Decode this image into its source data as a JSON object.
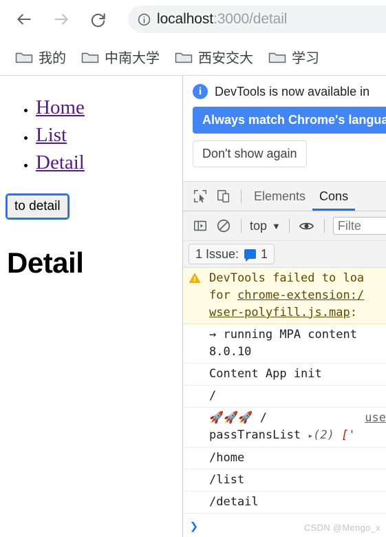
{
  "browser": {
    "nav": {
      "back_label": "Back",
      "forward_label": "Forward",
      "reload_label": "Reload"
    },
    "omnibox": {
      "site_info_icon": "info-circle-icon",
      "host": "localhost",
      "path": ":3000/detail",
      "full_url": "localhost:3000/detail"
    },
    "bookmarks": [
      {
        "label": "我的",
        "icon": "folder-icon"
      },
      {
        "label": "中南大学",
        "icon": "folder-icon"
      },
      {
        "label": "西安交大",
        "icon": "folder-icon"
      },
      {
        "label": "学习",
        "icon": "folder-icon"
      }
    ]
  },
  "page": {
    "nav_links": [
      {
        "label": "Home"
      },
      {
        "label": "List"
      },
      {
        "label": "Detail"
      }
    ],
    "button_label": "to detail",
    "heading": "Detail",
    "link_color": "#551a8b",
    "focus_ring_color": "#1a73e8"
  },
  "devtools": {
    "notification": {
      "icon": "info-icon",
      "glyph": "i",
      "message": "DevTools is now available in",
      "primary_button": "Always match Chrome's langua",
      "secondary_button": "Don't show again",
      "primary_color": "#4285f4"
    },
    "toolbar": {
      "inspect_icon": "inspect-element-icon",
      "device_icon": "device-toolbar-icon",
      "tabs": [
        {
          "label": "Elements",
          "active": false
        },
        {
          "label": "Cons",
          "active": true
        }
      ],
      "active_tab_color": "#1a73e8"
    },
    "console_toolbar": {
      "sidebar_icon": "console-sidebar-icon",
      "clear_icon": "clear-console-icon",
      "context": "top",
      "context_caret": "▼",
      "eye_icon": "live-expression-eye-icon",
      "filter_placeholder": "Filte"
    },
    "issues": {
      "label": "1 Issue:",
      "badge_icon": "issue-message-icon",
      "count": "1"
    },
    "messages": [
      {
        "type": "warning",
        "icon": "warning-triangle-icon",
        "line1": "DevTools failed to loa",
        "line2_prefix": "for ",
        "line2_link": "chrome-extension:/",
        "line3_link": "wser-polyfill.js.map",
        "line3_suffix": ":"
      },
      {
        "type": "log",
        "line1": "→ running MPA content",
        "line2": "8.0.10"
      },
      {
        "type": "log",
        "line1": "Content App init"
      },
      {
        "type": "log",
        "line1": "/"
      },
      {
        "type": "log",
        "rockets": "🚀🚀🚀",
        "line1": " /",
        "source_link": "use",
        "line2_label": "passTransList",
        "line2_expand": "▸",
        "line2_count": "(2)",
        "line2_value": "['"
      },
      {
        "type": "log",
        "line1": "/home"
      },
      {
        "type": "log",
        "line1": "/list"
      },
      {
        "type": "log",
        "line1": "/detail"
      }
    ],
    "prompt_caret": "❯"
  },
  "watermark": "CSDN @Mengo_x"
}
